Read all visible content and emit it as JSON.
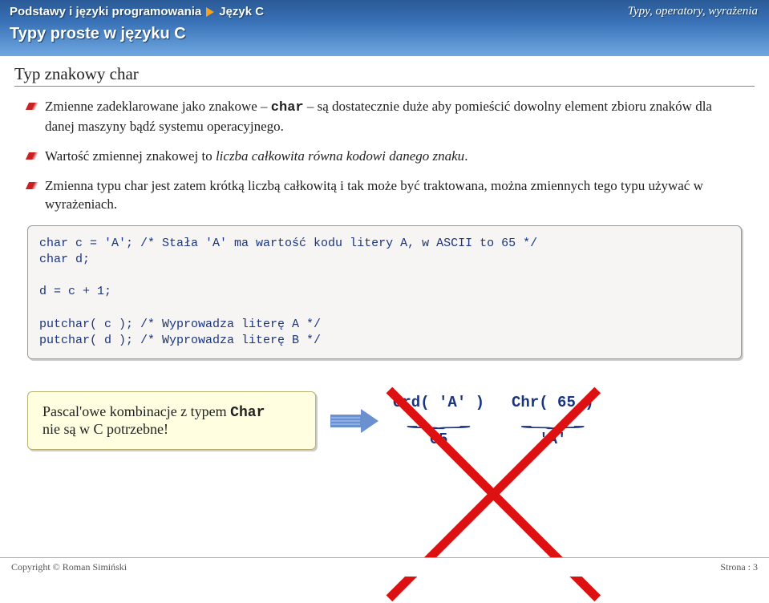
{
  "header": {
    "crumb1": "Podstawy i języki programowania",
    "crumb2": "Język C",
    "right": "Typy, operatory, wyrażenia",
    "subtitle": "Typy proste w języku C"
  },
  "section_title": "Typ znakowy char",
  "bullets": {
    "b1_pre": "Zmienne zadeklarowane jako znakowe – ",
    "b1_mono": "char",
    "b1_post": " – są dostatecznie duże aby pomieścić dowolny element zbioru znaków dla danej maszyny bądź systemu operacyjnego.",
    "b2_pre": "Wartość zmiennej znakowej to ",
    "b2_ital": "liczba całkowita równa kodowi danego znaku",
    "b2_post": ".",
    "b3": "Zmienna typu char jest zatem krótką liczbą całkowitą i tak może być traktowana, można zmiennych tego typu używać w wyrażeniach."
  },
  "code": "char c = 'A'; /* Stała 'A' ma wartość kodu litery A, w ASCII to 65 */\nchar d;\n\nd = c + 1;\n\nputchar( c ); /* Wyprowadza literę A */\nputchar( d ); /* Wyprowadza literę B */",
  "pascal": {
    "line1_pre": "Pascal'owe kombinacje z typem ",
    "line1_mono": "Char",
    "line2": "nie są w C potrzebne!"
  },
  "chunks": {
    "ord_expr": "Ord( 'A' )",
    "ord_result": "65",
    "chr_expr": "Chr( 65 )",
    "chr_result": "'A'"
  },
  "footer": {
    "left": "Copyright © Roman Simiński",
    "right": "Strona : 3"
  }
}
